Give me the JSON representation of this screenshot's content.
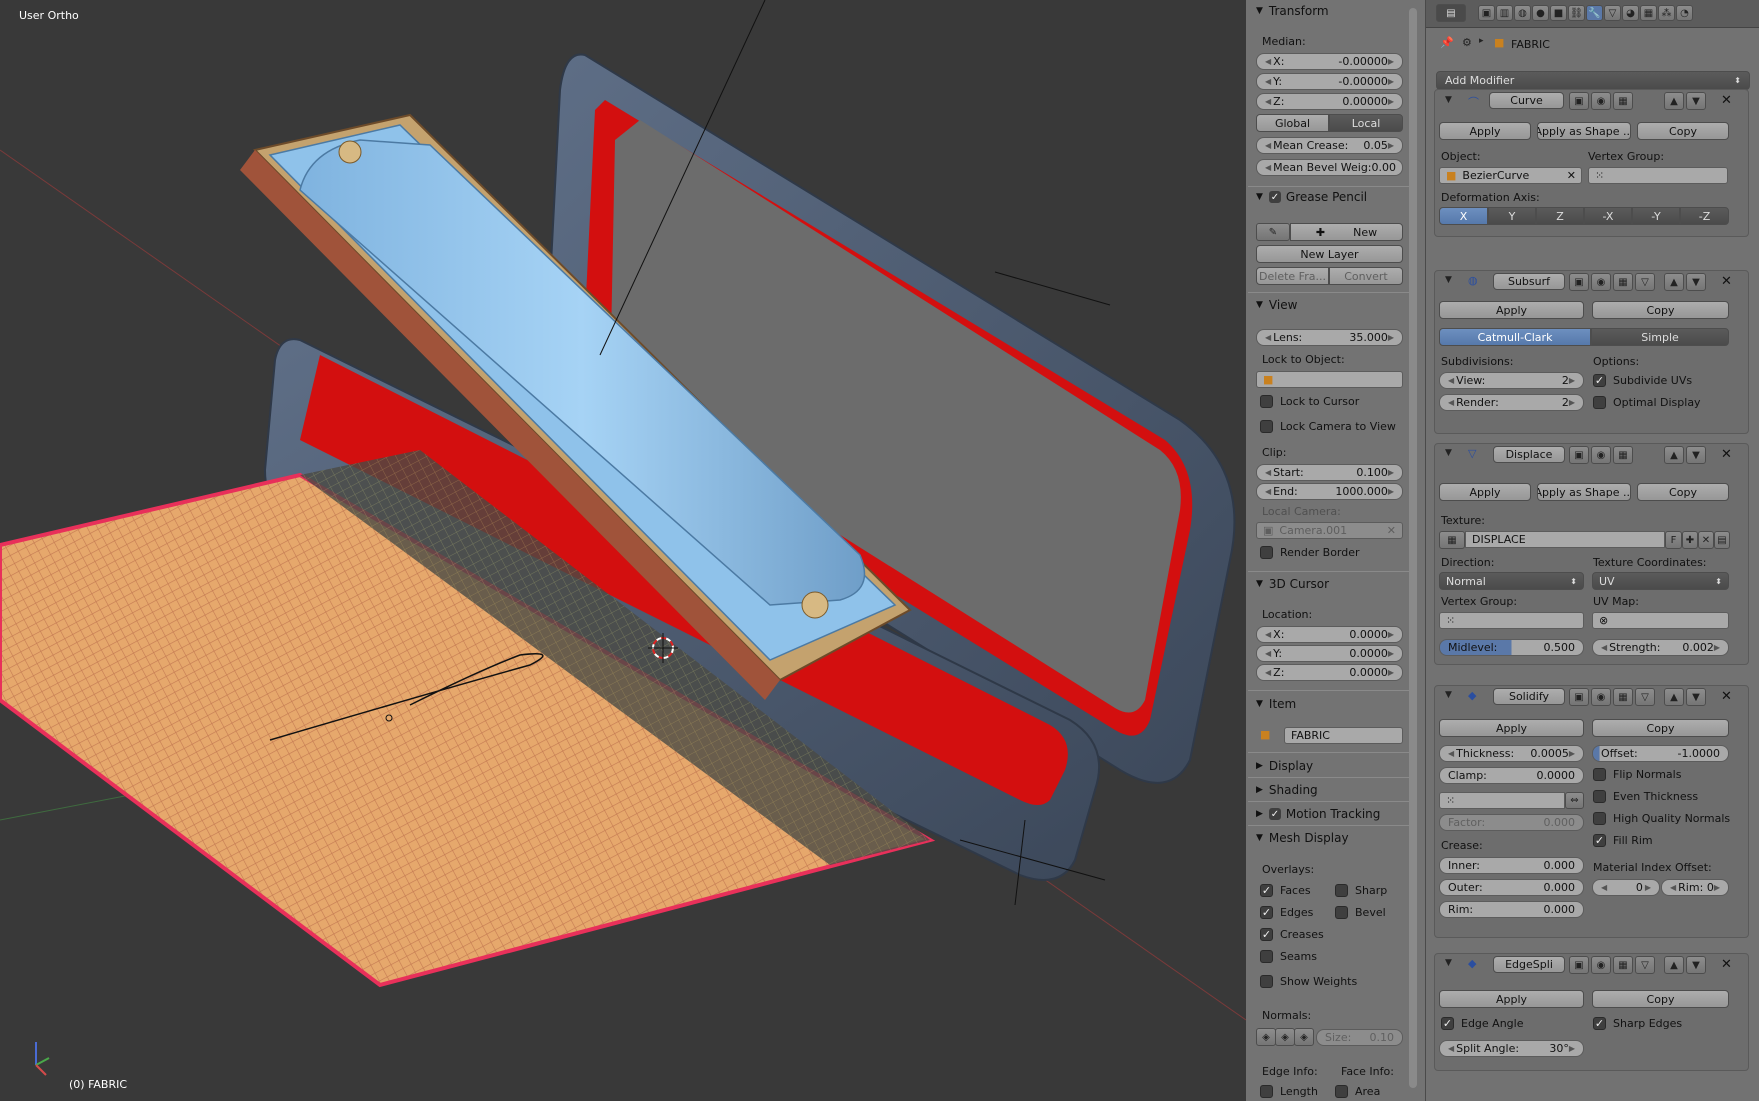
{
  "viewport": {
    "view_label": "User Ortho",
    "object_label": "(0) FABRIC"
  },
  "npanel": {
    "transform": {
      "title": "Transform",
      "median_label": "Median:",
      "x": {
        "label": "X:",
        "value": "-0.00000"
      },
      "y": {
        "label": "Y:",
        "value": "-0.00000"
      },
      "z": {
        "label": "Z:",
        "value": "0.00000"
      },
      "global": "Global",
      "local": "Local",
      "mean_crease": {
        "label": "Mean Crease:",
        "value": "0.05"
      },
      "mean_bevel": {
        "label": "Mean Bevel Weig:",
        "value": "0.00"
      }
    },
    "grease_pencil": {
      "title": "Grease Pencil",
      "new": "New",
      "new_layer": "New Layer",
      "delete_frame": "Delete Fra...",
      "convert": "Convert"
    },
    "view": {
      "title": "View",
      "lens": {
        "label": "Lens:",
        "value": "35.000"
      },
      "lock_to_object": "Lock to Object:",
      "lock_to_cursor": "Lock to Cursor",
      "lock_camera": "Lock Camera to View",
      "clip": "Clip:",
      "start": {
        "label": "Start:",
        "value": "0.100"
      },
      "end": {
        "label": "End:",
        "value": "1000.000"
      },
      "local_camera": "Local Camera:",
      "camera": "Camera.001",
      "render_border": "Render Border"
    },
    "cursor": {
      "title": "3D Cursor",
      "location": "Location:",
      "x": {
        "label": "X:",
        "value": "0.0000"
      },
      "y": {
        "label": "Y:",
        "value": "0.0000"
      },
      "z": {
        "label": "Z:",
        "value": "0.0000"
      }
    },
    "item": {
      "title": "Item",
      "name": "FABRIC"
    },
    "display": "Display",
    "shading": "Shading",
    "motion_tracking": "Motion Tracking",
    "mesh_display": {
      "title": "Mesh Display",
      "overlays": "Overlays:",
      "faces": "Faces",
      "sharp": "Sharp",
      "edges": "Edges",
      "bevel": "Bevel",
      "creases": "Creases",
      "seams": "Seams",
      "show_weights": "Show Weights",
      "normals": "Normals:",
      "size": {
        "label": "Size:",
        "value": "0.10"
      },
      "edge_info": "Edge Info:",
      "face_info": "Face Info:",
      "length": "Length",
      "area": "Area"
    }
  },
  "props": {
    "object_name": "FABRIC",
    "add_modifier": "Add Modifier",
    "apply": "Apply",
    "apply_shape": "Apply as Shape ...",
    "copy": "Copy",
    "curve": {
      "name": "Curve",
      "object_label": "Object:",
      "object_value": "BezierCurve",
      "vertex_group": "Vertex Group:",
      "deformation_axis": "Deformation Axis:",
      "axes": [
        "X",
        "Y",
        "Z",
        "-X",
        "-Y",
        "-Z"
      ]
    },
    "subsurf": {
      "name": "Subsurf",
      "catmull": "Catmull-Clark",
      "simple": "Simple",
      "subdivisions": "Subdivisions:",
      "options": "Options:",
      "view": {
        "label": "View:",
        "value": "2"
      },
      "render": {
        "label": "Render:",
        "value": "2"
      },
      "subdivide_uvs": "Subdivide UVs",
      "optimal_display": "Optimal Display"
    },
    "displace": {
      "name": "Displace",
      "texture_label": "Texture:",
      "texture": "DISPLACE",
      "f": "F",
      "direction": "Direction:",
      "direction_value": "Normal",
      "tex_coords": "Texture Coordinates:",
      "tex_coords_value": "UV",
      "vertex_group": "Vertex Group:",
      "uv_map": "UV Map:",
      "midlevel": {
        "label": "Midlevel:",
        "value": "0.500"
      },
      "strength": {
        "label": "Strength:",
        "value": "0.002"
      }
    },
    "solidify": {
      "name": "Solidify",
      "thickness": {
        "label": "Thickness:",
        "value": "0.0005"
      },
      "offset": {
        "label": "Offset:",
        "value": "-1.0000"
      },
      "clamp": {
        "label": "Clamp:",
        "value": "0.0000"
      },
      "flip_normals": "Flip Normals",
      "even_thickness": "Even Thickness",
      "high_quality": "High Quality Normals",
      "fill_rim": "Fill Rim",
      "factor": {
        "label": "Factor:",
        "value": "0.000"
      },
      "crease": "Crease:",
      "inner": {
        "label": "Inner:",
        "value": "0.000"
      },
      "outer": {
        "label": "Outer:",
        "value": "0.000"
      },
      "rim": {
        "label": "Rim:",
        "value": "0.000"
      },
      "material_offset": "Material Index Offset:",
      "mat_offset_value": "0",
      "rim_label": "Rim:",
      "rim_value": "0"
    },
    "edgesplit": {
      "name": "EdgeSpli",
      "edge_angle": "Edge Angle",
      "sharp_edges": "Sharp Edges",
      "split_angle": {
        "label": "Split Angle:",
        "value": "30°"
      }
    }
  }
}
